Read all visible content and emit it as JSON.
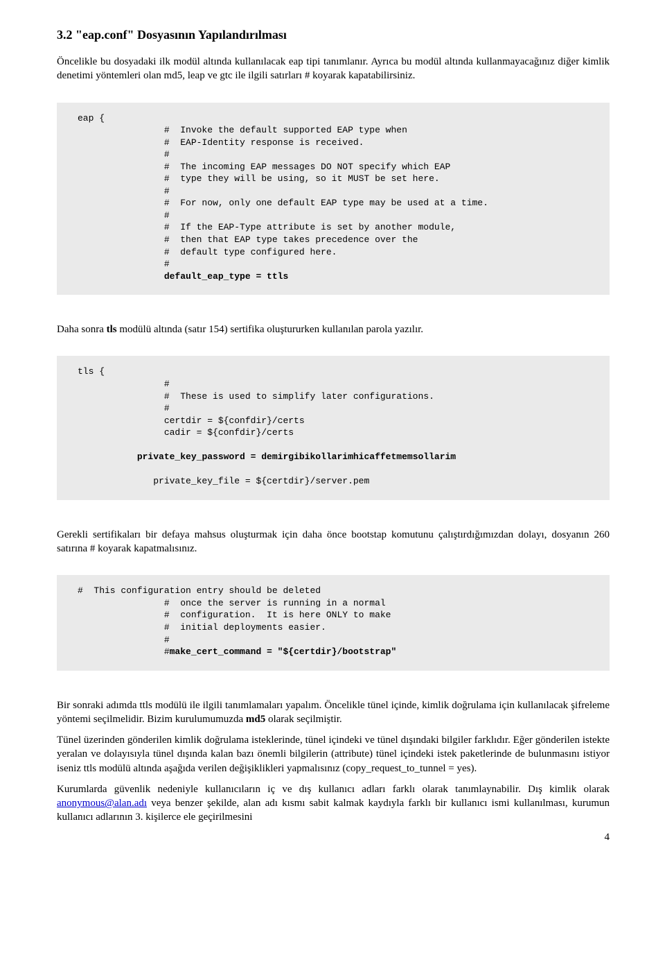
{
  "heading": "3.2 \"eap.conf\" Dosyasının Yapılandırılması",
  "intro_p1": "Öncelikle bu dosyadaki ilk modül altında kullanılacak eap tipi tanımlanır. Ayrıca bu modül altında kullanmayacağınız diğer kimlik denetimi yöntemleri olan md5, leap ve gtc ile ilgili satırları # koyarak kapatabilirsiniz.",
  "code1": {
    "l01": "eap {",
    "l02": "                #  Invoke the default supported EAP type when",
    "l03": "                #  EAP-Identity response is received.",
    "l04": "                #",
    "l05": "                #  The incoming EAP messages DO NOT specify which EAP",
    "l06": "                #  type they will be using, so it MUST be set here.",
    "l07": "                #",
    "l08": "                #  For now, only one default EAP type may be used at a time.",
    "l09": "                #",
    "l10": "                #  If the EAP-Type attribute is set by another module,",
    "l11": "                #  then that EAP type takes precedence over the",
    "l12": "                #  default type configured here.",
    "l13": "                #",
    "l14a": "                ",
    "l14b": "default_eap_type = ttls"
  },
  "p2a": "Daha sonra ",
  "p2b": "tls",
  "p2c": " modülü altında (satır 154) sertifika oluştururken kullanılan parola yazılır.",
  "code2": {
    "l01": "tls {",
    "l02": "                #",
    "l03": "                #  These is used to simplify later configurations.",
    "l04": "                #",
    "l05": "                certdir = ${confdir}/certs",
    "l06": "                cadir = ${confdir}/certs",
    "blank": "",
    "l07a": "           ",
    "l07b": "private_key_password = demirgibikollarimhicaffetmemsollarim",
    "l08": "              private_key_file = ${certdir}/server.pem"
  },
  "p3": "Gerekli sertifikaları bir defaya mahsus oluşturmak için daha önce bootstap komutunu çalıştırdığımızdan dolayı, dosyanın  260 satırına #  koyarak kapatmalısınız.",
  "code3": {
    "l01": "#  This configuration entry should be deleted",
    "l02": "                #  once the server is running in a normal",
    "l03": "                #  configuration.  It is here ONLY to make",
    "l04": "                #  initial deployments easier.",
    "l05": "                #",
    "l06a": "                #",
    "l06b": "make_cert_command = \"${certdir}/bootstrap\""
  },
  "p4a": "Bir sonraki adımda ttls modülü ile ilgili tanımlamaları yapalım. Öncelikle tünel içinde, kimlik doğrulama için kullanılacak şifreleme yöntemi seçilmelidir. Bizim kurulumumuzda ",
  "p4b": "md5",
  "p4c": " olarak seçilmiştir.",
  "p5": "Tünel üzerinden gönderilen kimlik doğrulama isteklerinde, tünel içindeki ve tünel dışındaki bilgiler farklıdır. Eğer gönderilen istekte yeralan ve dolayısıyla tünel dışında kalan bazı önemli bilgilerin (attribute) tünel içindeki istek paketlerinde de bulunmasını istiyor iseniz ttls modülü altında aşağıda verilen değişiklikleri yapmalısınız (copy_request_to_tunnel = yes).",
  "p6a": "Kurumlarda güvenlik nedeniyle kullanıcıların iç ve dış kullanıcı adları farklı olarak tanımlaynabilir. Dış kimlik olarak ",
  "p6link": "anonymous@alan.adı",
  "p6b": " veya benzer şekilde, alan adı kısmı sabit kalmak kaydıyla farklı bir kullanıcı ismi kullanılması, kurumun kullanıcı adlarının 3. kişilerce ele geçirilmesini",
  "pagenum": "4"
}
